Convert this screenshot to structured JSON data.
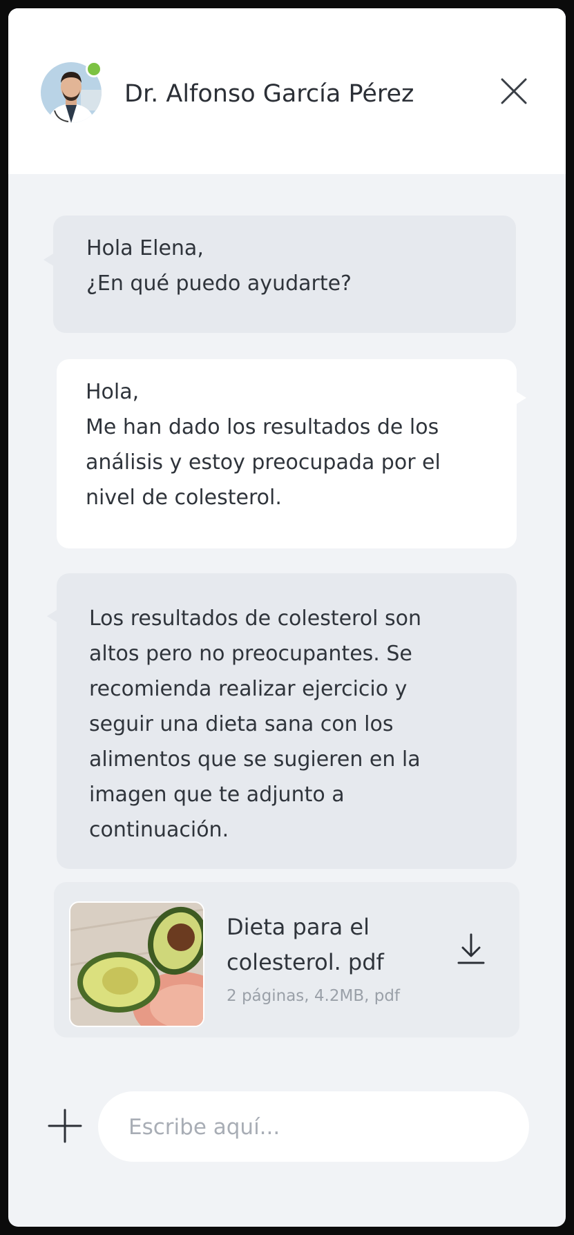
{
  "header": {
    "doctor_name": "Dr. Alfonso García Pérez",
    "status": "online",
    "status_color": "#7cc242",
    "avatar_icon": "doctor-avatar",
    "close_icon": "close-icon"
  },
  "messages": [
    {
      "sender": "doctor",
      "text": "Hola Elena,\n¿En qué puedo ayudarte?"
    },
    {
      "sender": "patient",
      "text": "Hola,\nMe han dado los resultados de los\nanálisis y estoy preocupada por el\nnivel de colesterol."
    },
    {
      "sender": "doctor",
      "text": "Los resultados de colesterol son\naltos pero no preocupantes. Se\nrecomienda realizar ejercicio y\nseguir una dieta sana con los\nalimentos que se sugieren en la\nimagen que te adjunto a\ncontinuación."
    }
  ],
  "attachment": {
    "file_name": "Dieta para el colesterol. pdf",
    "meta": "2 páginas, 4.2MB, pdf",
    "thumbnail": "avocado-image",
    "download_icon": "download-icon"
  },
  "composer": {
    "placeholder": "Escribe aquí...",
    "value": "",
    "add_icon": "plus-icon"
  },
  "colors": {
    "background": "#f1f3f6",
    "incoming_bubble": "#e6e9ee",
    "outgoing_bubble": "#ffffff",
    "online": "#7cc242"
  }
}
